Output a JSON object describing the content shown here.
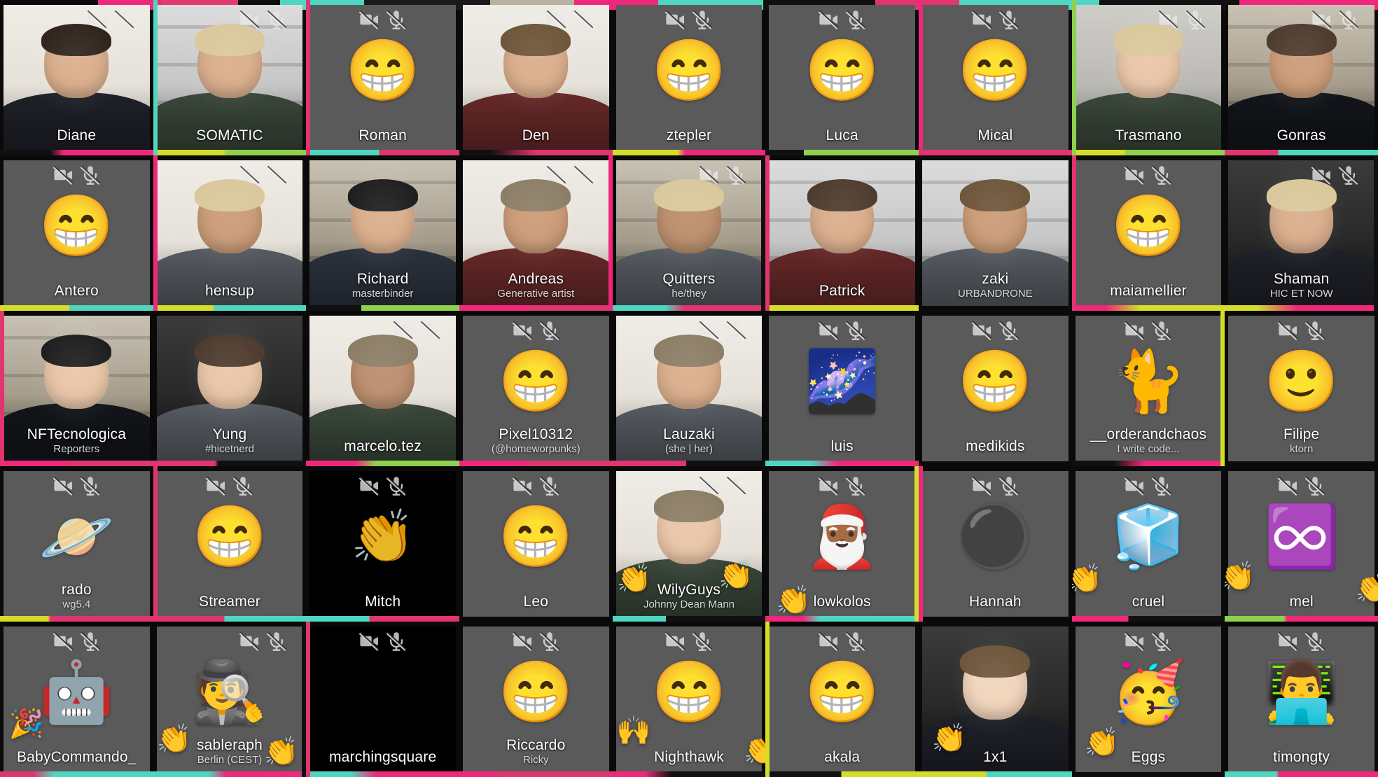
{
  "app": {
    "title": "Video conference gallery view",
    "layout": {
      "columns": 9,
      "rows": 5
    },
    "icons": {
      "video_off": "video-off-icon",
      "mic_off": "mic-off-icon"
    },
    "colors": {
      "tile_placeholder_bg": "#5a5a5a",
      "tile_dark_bg": "#000000",
      "name_text": "#ffffff",
      "subtitle_text": "#d8d8d8",
      "glitch_pink": "#f0277a",
      "glitch_teal": "#4fd6c0",
      "glitch_yellow": "#d4dd2a",
      "page_bg": "#000000"
    }
  },
  "participants": [
    {
      "name": "Diane",
      "subtitle": "",
      "kind": "video",
      "skin": "wall-white",
      "muted": true,
      "mute_align": "right",
      "avatar": "",
      "reactions": []
    },
    {
      "name": "SOMATIC",
      "subtitle": "",
      "kind": "video",
      "skin": "wall-office",
      "muted": true,
      "mute_align": "right",
      "avatar": "",
      "reactions": []
    },
    {
      "name": "Roman",
      "subtitle": "",
      "kind": "avatar",
      "skin": "",
      "muted": true,
      "mute_align": "center",
      "avatar": "😁",
      "reactions": []
    },
    {
      "name": "Den",
      "subtitle": "",
      "kind": "video",
      "skin": "wall-white",
      "muted": true,
      "mute_align": "right",
      "avatar": "",
      "reactions": []
    },
    {
      "name": "ztepler",
      "subtitle": "",
      "kind": "avatar",
      "skin": "",
      "muted": true,
      "mute_align": "center",
      "avatar": "😁",
      "reactions": []
    },
    {
      "name": "Luca",
      "subtitle": "",
      "kind": "avatar",
      "skin": "",
      "muted": true,
      "mute_align": "center",
      "avatar": "😁",
      "reactions": []
    },
    {
      "name": "Mical",
      "subtitle": "",
      "kind": "avatar",
      "skin": "",
      "muted": true,
      "mute_align": "center",
      "avatar": "😁",
      "reactions": []
    },
    {
      "name": "Trasmano",
      "subtitle": "",
      "kind": "video",
      "skin": "wall-grey",
      "muted": true,
      "mute_align": "right",
      "avatar": "",
      "reactions": []
    },
    {
      "name": "Gonras",
      "subtitle": "",
      "kind": "video",
      "skin": "wall-room",
      "muted": true,
      "mute_align": "right",
      "avatar": "",
      "reactions": []
    },
    {
      "name": "Antero",
      "subtitle": "",
      "kind": "avatar",
      "skin": "",
      "muted": true,
      "mute_align": "center",
      "avatar": "😁",
      "reactions": []
    },
    {
      "name": "hensup",
      "subtitle": "",
      "kind": "video",
      "skin": "wall-white",
      "muted": true,
      "mute_align": "right",
      "avatar": "",
      "reactions": []
    },
    {
      "name": "Richard",
      "subtitle": "masterbinder",
      "kind": "video",
      "skin": "wall-room",
      "muted": false,
      "mute_align": "right",
      "avatar": "",
      "reactions": []
    },
    {
      "name": "Andreas",
      "subtitle": "Generative artist",
      "kind": "video",
      "skin": "wall-white",
      "muted": true,
      "mute_align": "right",
      "avatar": "",
      "reactions": []
    },
    {
      "name": "Quitters",
      "subtitle": "he/they",
      "kind": "video",
      "skin": "wall-room",
      "muted": true,
      "mute_align": "right",
      "avatar": "",
      "reactions": []
    },
    {
      "name": "Patrick",
      "subtitle": "",
      "kind": "video",
      "skin": "wall-office",
      "muted": false,
      "mute_align": "right",
      "avatar": "",
      "reactions": []
    },
    {
      "name": "zaki",
      "subtitle": "URBANDRONE",
      "kind": "video",
      "skin": "wall-office",
      "muted": false,
      "mute_align": "right",
      "avatar": "",
      "reactions": []
    },
    {
      "name": "maiamellier",
      "subtitle": "",
      "kind": "avatar",
      "skin": "",
      "muted": true,
      "mute_align": "center",
      "avatar": "😁",
      "reactions": []
    },
    {
      "name": "Shaman",
      "subtitle": "HIC ET NOW",
      "kind": "video",
      "skin": "wall-dark",
      "muted": true,
      "mute_align": "right",
      "avatar": "",
      "reactions": []
    },
    {
      "name": "NFTecnologica",
      "subtitle": "Reporters",
      "kind": "video",
      "skin": "wall-room",
      "muted": false,
      "mute_align": "right",
      "avatar": "",
      "reactions": []
    },
    {
      "name": "Yung",
      "subtitle": "#hicetnerd",
      "kind": "video",
      "skin": "wall-dark",
      "muted": false,
      "mute_align": "right",
      "avatar": "",
      "reactions": []
    },
    {
      "name": "marcelo.tez",
      "subtitle": "",
      "kind": "video",
      "skin": "wall-white",
      "muted": true,
      "mute_align": "right",
      "avatar": "",
      "reactions": []
    },
    {
      "name": "Pixel10312",
      "subtitle": "(@homeworpunks)",
      "kind": "avatar",
      "skin": "",
      "muted": true,
      "mute_align": "center",
      "avatar": "😁",
      "reactions": []
    },
    {
      "name": "Lauzaki",
      "subtitle": "(she | her)",
      "kind": "video",
      "skin": "wall-white",
      "muted": true,
      "mute_align": "right",
      "avatar": "",
      "reactions": []
    },
    {
      "name": "luis",
      "subtitle": "",
      "kind": "avatar",
      "skin": "",
      "muted": true,
      "mute_align": "center",
      "avatar": "🌌",
      "reactions": []
    },
    {
      "name": "medikids",
      "subtitle": "",
      "kind": "avatar",
      "skin": "",
      "muted": true,
      "mute_align": "center",
      "avatar": "😁",
      "reactions": []
    },
    {
      "name": "__orderandchaos",
      "subtitle": "I write code...",
      "kind": "avatar",
      "skin": "",
      "muted": true,
      "mute_align": "center",
      "avatar": "🐈",
      "reactions": []
    },
    {
      "name": "Filipe",
      "subtitle": "ktorn",
      "kind": "avatar",
      "skin": "",
      "muted": true,
      "mute_align": "center",
      "avatar": "🙂",
      "reactions": []
    },
    {
      "name": "rado",
      "subtitle": "wg5.4",
      "kind": "avatar",
      "skin": "",
      "muted": true,
      "mute_align": "center",
      "avatar": "🪐",
      "reactions": []
    },
    {
      "name": "Streamer",
      "subtitle": "",
      "kind": "avatar",
      "skin": "",
      "muted": true,
      "mute_align": "center",
      "avatar": "😁",
      "reactions": []
    },
    {
      "name": "Mitch",
      "subtitle": "",
      "kind": "dark",
      "skin": "",
      "muted": true,
      "mute_align": "center",
      "avatar": "👏",
      "reactions": []
    },
    {
      "name": "Leo",
      "subtitle": "",
      "kind": "avatar",
      "skin": "",
      "muted": true,
      "mute_align": "center",
      "avatar": "😁",
      "reactions": []
    },
    {
      "name": "WilyGuys",
      "subtitle": "Johnny Dean Mann",
      "kind": "video",
      "skin": "wall-white",
      "muted": true,
      "mute_align": "right",
      "avatar": "",
      "reactions": [
        "👏",
        "👏"
      ]
    },
    {
      "name": "lowkolos",
      "subtitle": "",
      "kind": "avatar",
      "skin": "",
      "muted": true,
      "mute_align": "center",
      "avatar": "🎅🏾",
      "reactions": [
        "👏"
      ]
    },
    {
      "name": "Hannah",
      "subtitle": "",
      "kind": "avatar",
      "skin": "",
      "muted": true,
      "mute_align": "center",
      "avatar": "⚫",
      "reactions": []
    },
    {
      "name": "cruel",
      "subtitle": "",
      "kind": "avatar",
      "skin": "",
      "muted": true,
      "mute_align": "center",
      "avatar": "🧊",
      "reactions": [
        "👏"
      ]
    },
    {
      "name": "mel",
      "subtitle": "",
      "kind": "avatar",
      "skin": "",
      "muted": true,
      "mute_align": "center",
      "avatar": "♾️",
      "reactions": [
        "👏",
        "👏"
      ]
    },
    {
      "name": "BabyCommando_",
      "subtitle": "",
      "kind": "avatar",
      "skin": "",
      "muted": true,
      "mute_align": "center",
      "avatar": "🤖",
      "reactions": [
        "🎉"
      ]
    },
    {
      "name": "sableraph",
      "subtitle": "Berlin (CEST)",
      "kind": "avatar",
      "skin": "",
      "muted": true,
      "mute_align": "right",
      "avatar": "🕵️",
      "reactions": [
        "👏",
        "👏"
      ]
    },
    {
      "name": "marchingsquare",
      "subtitle": "",
      "kind": "dark",
      "skin": "",
      "muted": true,
      "mute_align": "center",
      "avatar": "",
      "reactions": []
    },
    {
      "name": "Riccardo",
      "subtitle": "Ricky",
      "kind": "avatar",
      "skin": "",
      "muted": true,
      "mute_align": "center",
      "avatar": "😁",
      "reactions": []
    },
    {
      "name": "Nighthawk",
      "subtitle": "",
      "kind": "avatar",
      "skin": "",
      "muted": true,
      "mute_align": "center",
      "avatar": "😁",
      "reactions": [
        "🙌",
        "👏"
      ]
    },
    {
      "name": "akala",
      "subtitle": "",
      "kind": "avatar",
      "skin": "",
      "muted": true,
      "mute_align": "center",
      "avatar": "😁",
      "reactions": []
    },
    {
      "name": "1x1",
      "subtitle": "",
      "kind": "video",
      "skin": "wall-dark",
      "muted": false,
      "mute_align": "right",
      "avatar": "",
      "reactions": [
        "👏"
      ]
    },
    {
      "name": "Eggs",
      "subtitle": "",
      "kind": "avatar",
      "skin": "",
      "muted": true,
      "mute_align": "center",
      "avatar": "🥳",
      "reactions": [
        "👏"
      ]
    },
    {
      "name": "timongty",
      "subtitle": "",
      "kind": "avatar",
      "skin": "",
      "muted": true,
      "mute_align": "center",
      "avatar": "👨‍💻",
      "reactions": []
    }
  ]
}
